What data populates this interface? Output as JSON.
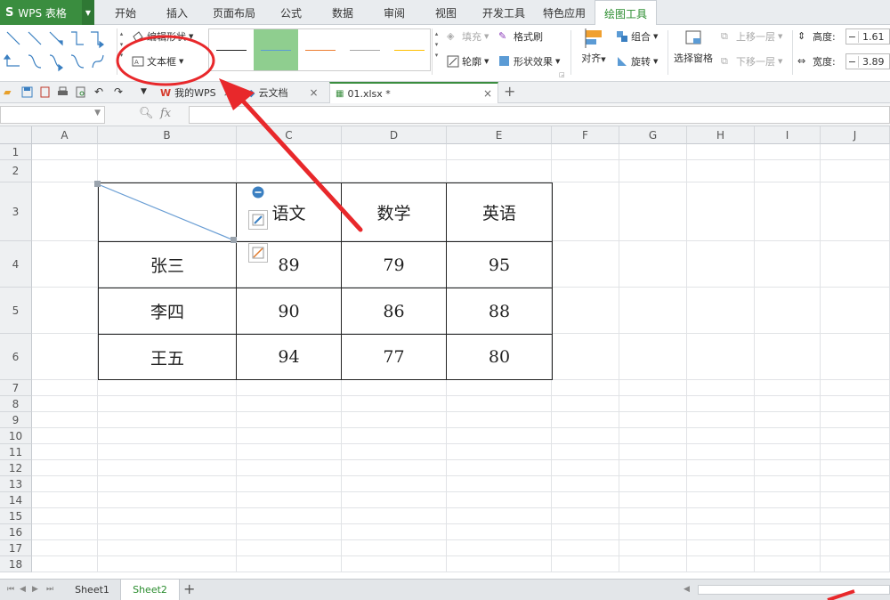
{
  "app": {
    "logo": "S",
    "name": "WPS 表格"
  },
  "menu_tabs": [
    {
      "label": "开始"
    },
    {
      "label": "插入"
    },
    {
      "label": "页面布局"
    },
    {
      "label": "公式"
    },
    {
      "label": "数据"
    },
    {
      "label": "审阅"
    },
    {
      "label": "视图"
    },
    {
      "label": "开发工具"
    },
    {
      "label": "特色应用"
    },
    {
      "label": "绘图工具"
    }
  ],
  "ribbon": {
    "edit_shape": "编辑形状",
    "text_box": "文本框",
    "fill": "填充",
    "format_painter": "格式刷",
    "outline": "轮廓",
    "shape_effects": "形状效果",
    "align": "对齐",
    "group": "组合",
    "rotate": "旋转",
    "selection_pane": "选择窗格",
    "bring_forward": "上移一层",
    "send_backward": "下移一层",
    "height_label": "高度:",
    "height_value": "1.61",
    "width_label": "宽度:",
    "width_value": "3.89",
    "line_colors": [
      "#222222",
      "#5b9bd5",
      "#ed7d31",
      "#a5a5a5",
      "#ffc000"
    ]
  },
  "doc_tabs": [
    {
      "label": "我的WPS"
    },
    {
      "label": "云文档"
    },
    {
      "label": "01.xlsx *"
    }
  ],
  "formula": {
    "fx": "fx",
    "name_box": "",
    "value": ""
  },
  "columns": [
    "A",
    "B",
    "C",
    "D",
    "E",
    "F",
    "G",
    "H",
    "I",
    "J"
  ],
  "rows": [
    "1",
    "2",
    "3",
    "4",
    "5",
    "6",
    "7",
    "8",
    "9",
    "10",
    "11",
    "12",
    "13",
    "14",
    "15",
    "16",
    "17",
    "18"
  ],
  "table": {
    "headers": [
      "",
      "语文",
      "数学",
      "英语"
    ],
    "rows": [
      [
        "张三",
        "89",
        "79",
        "95"
      ],
      [
        "李四",
        "90",
        "86",
        "88"
      ],
      [
        "王五",
        "94",
        "77",
        "80"
      ]
    ]
  },
  "sheets": [
    {
      "label": "Sheet1"
    },
    {
      "label": "Sheet2"
    }
  ],
  "colors": {
    "accent": "#3a8d3f",
    "annotation": "#e8282b"
  }
}
